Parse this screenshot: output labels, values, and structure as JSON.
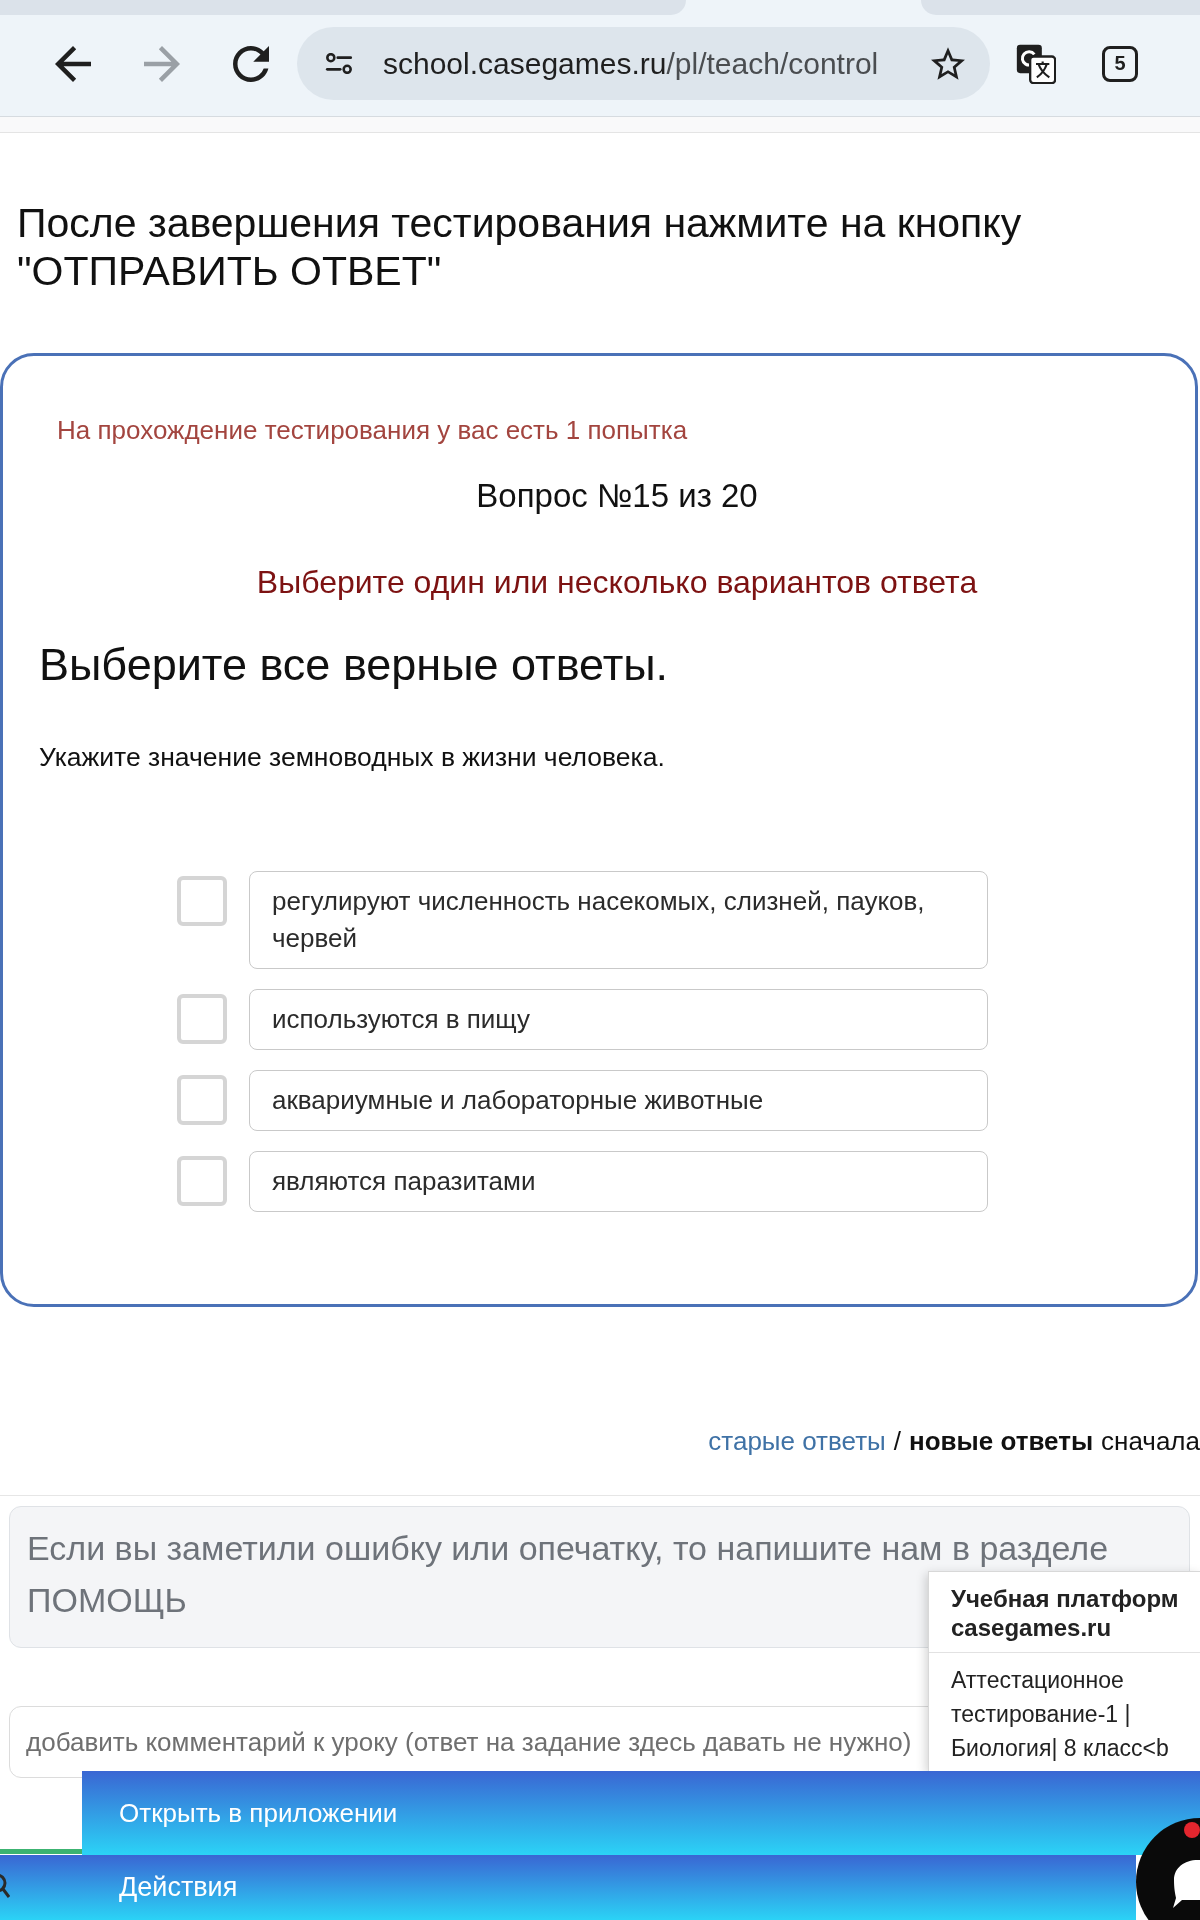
{
  "browser": {
    "back": {
      "disabled": false
    },
    "forward": {
      "disabled": true
    },
    "url": {
      "host": "school.casegames.ru",
      "path": "/pl/teach/control"
    },
    "tab_count": "5"
  },
  "instruction": "После завершения тестирования нажмите на кнопку \"ОТПРАВИТЬ ОТВЕТ\"",
  "test_card": {
    "attempts_note": "На прохождение тестирования у вас есть 1 попытка",
    "question_counter": "Вопрос №15 из 20",
    "answer_hint": "Выберите один или несколько вариантов ответа",
    "title": "Выберите все верные ответы.",
    "question": "Укажите значение земноводных в жизни человека.",
    "options": [
      {
        "label": "регулируют численность насекомых, слизней, пауков, червей",
        "checked": false
      },
      {
        "label": "используются в пищу",
        "checked": false
      },
      {
        "label": "аквариумные и лабораторные животные",
        "checked": false
      },
      {
        "label": "являются паразитами",
        "checked": false
      }
    ]
  },
  "answer_order": {
    "options": [
      {
        "label": "старые ответы",
        "selected": false
      },
      {
        "label": "новые ответы",
        "selected": true
      }
    ],
    "separator": "/",
    "suffix": "сначала"
  },
  "error_notice": "Если вы заметили ошибку или опечатку, то напишите нам в разделе ПОМОЩЬ",
  "comment_field": {
    "placeholder": "добавить комментарий к уроку (ответ на задание здесь давать не нужно)"
  },
  "notification_popup": {
    "title": "Учебная платформ casegames.ru",
    "body": "Аттестационное тестирование-1 | Биология| 8 класс<b"
  },
  "app_banner": {
    "open_in_app": "Открыть в приложении",
    "actions": "Действия"
  },
  "chat_button": {
    "has_notification": true
  }
}
